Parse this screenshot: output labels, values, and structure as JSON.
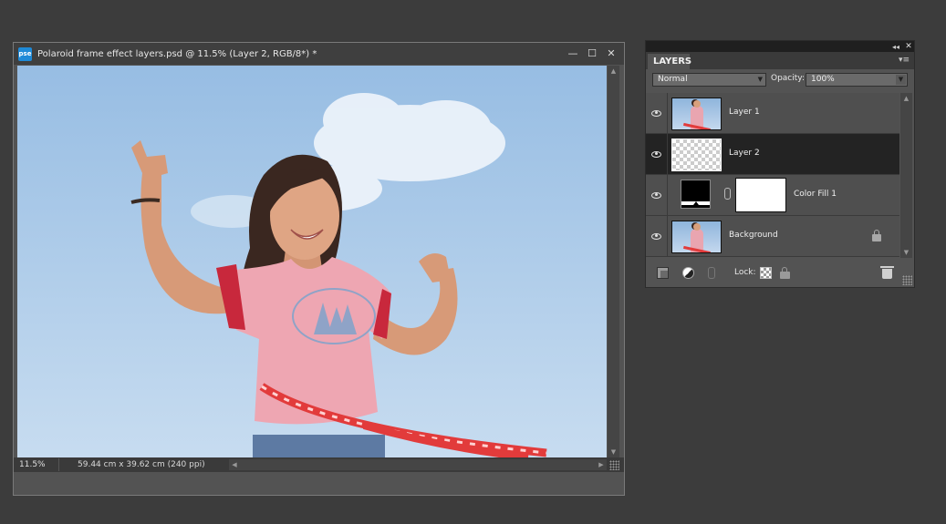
{
  "document": {
    "logo_text": "pse",
    "title": "Polaroid frame effect layers.psd @ 11.5% (Layer 2, RGB/8*) *",
    "controls": {
      "minimize": "—",
      "maximize": "☐",
      "close": "✕"
    },
    "status": {
      "zoom": "11.5%",
      "size": "59.44 cm x 39.62 cm (240 ppi)",
      "menu_arrow": "▶"
    }
  },
  "layers_panel": {
    "tab_label": "LAYERS",
    "collapse_glyph": "◂◂",
    "close_glyph": "✕",
    "menu_glyph": "▾≡",
    "blend_mode": "Normal",
    "opacity_label": "Opacity:",
    "opacity_value": "100%",
    "lock_label": "Lock:",
    "layers": [
      {
        "name": "Layer 1",
        "visible": true,
        "selected": false
      },
      {
        "name": "Layer 2",
        "visible": true,
        "selected": true
      },
      {
        "name": "Color Fill 1",
        "visible": true,
        "selected": false
      },
      {
        "name": "Background",
        "visible": true,
        "selected": false,
        "locked": true
      }
    ]
  },
  "colors": {
    "ui_background": "#3c3c3c",
    "panel": "#535353",
    "selected_row": "#232323",
    "sky": "#a9c8e8",
    "shirt": "#eea6b2",
    "hoop": "#e23b3b"
  }
}
